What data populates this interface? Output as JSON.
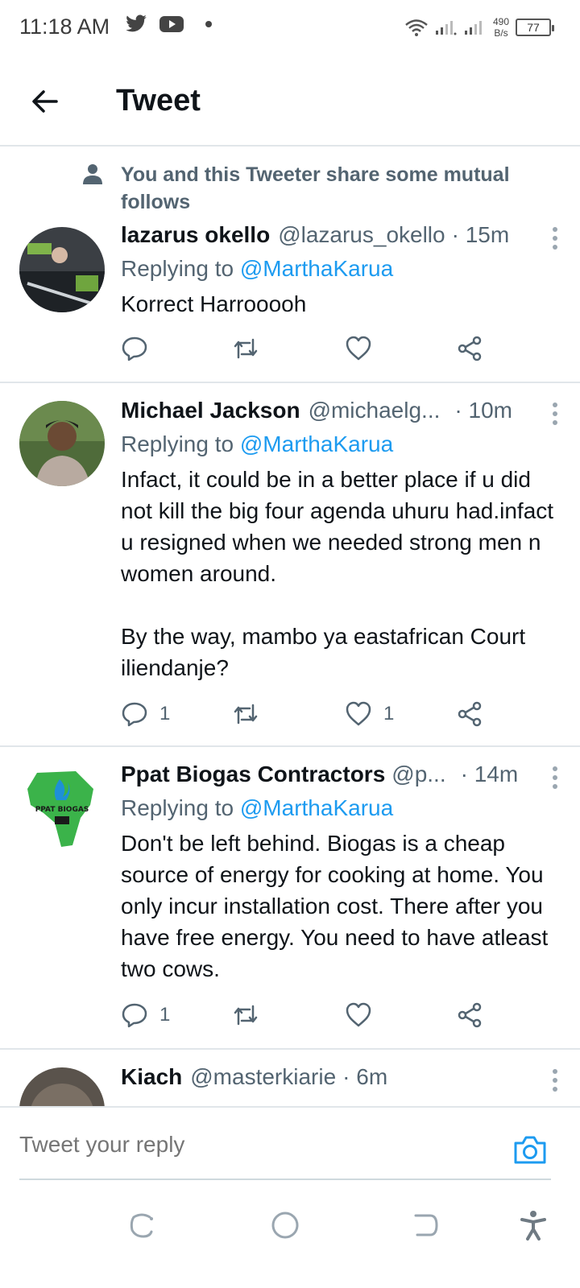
{
  "status_bar": {
    "time": "11:18 AM",
    "speed_value": "490",
    "speed_unit": "B/s",
    "battery": "77",
    "icons": [
      "twitter-icon",
      "youtube-icon",
      "wifi-icon",
      "signal-icon",
      "signal-icon"
    ]
  },
  "header": {
    "title": "Tweet"
  },
  "mutual_notice": "You and this Tweeter share some mutual follows",
  "tweets": [
    {
      "name": "lazarus okello",
      "handle": "@lazarus_okello",
      "time": "· 15m",
      "replying_prefix": "Replying to",
      "replying_to": "@MarthaKarua",
      "text": "Korrect  Harrooooh",
      "reply_count": "",
      "like_count": ""
    },
    {
      "name": "Michael Jackson",
      "handle": "@michaelg...",
      "time": "· 10m",
      "replying_prefix": "Replying to",
      "replying_to": "@MarthaKarua",
      "text": "Infact, it could be in a better place if u did not kill the big four agenda uhuru had.infact u resigned when we needed strong men n women around.\n\nBy the way, mambo ya eastafrican Court iliendanje?",
      "reply_count": "1",
      "like_count": "1"
    },
    {
      "name": "Ppat Biogas Contractors",
      "handle": "@p...",
      "time": "· 14m",
      "replying_prefix": "Replying to",
      "replying_to": "@MarthaKarua",
      "text": "Don't be left behind. Biogas is a cheap source of energy for cooking at home. You only incur installation cost. There after you have free energy. You need to have atleast two cows.",
      "reply_count": "1",
      "like_count": "",
      "logo_text": "PPAT BIOGAS"
    },
    {
      "name": "Kiach",
      "handle": "@masterkiarie",
      "time": "· 6m"
    }
  ],
  "reply_bar": {
    "placeholder": "Tweet your reply"
  },
  "colors": {
    "accent": "#1d9bf0",
    "secondary_text": "#536471"
  }
}
